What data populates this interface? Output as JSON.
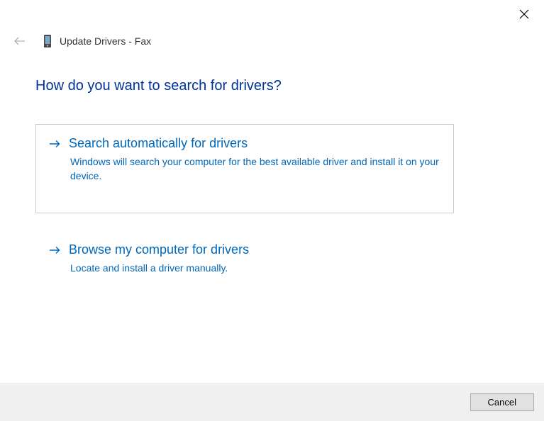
{
  "window": {
    "title": "Update Drivers - Fax"
  },
  "question": "How do you want to search for drivers?",
  "options": [
    {
      "title": "Search automatically for drivers",
      "desc": "Windows will search your computer for the best available driver and install it on your device."
    },
    {
      "title": "Browse my computer for drivers",
      "desc": "Locate and install a driver manually."
    }
  ],
  "footer": {
    "cancel": "Cancel"
  }
}
